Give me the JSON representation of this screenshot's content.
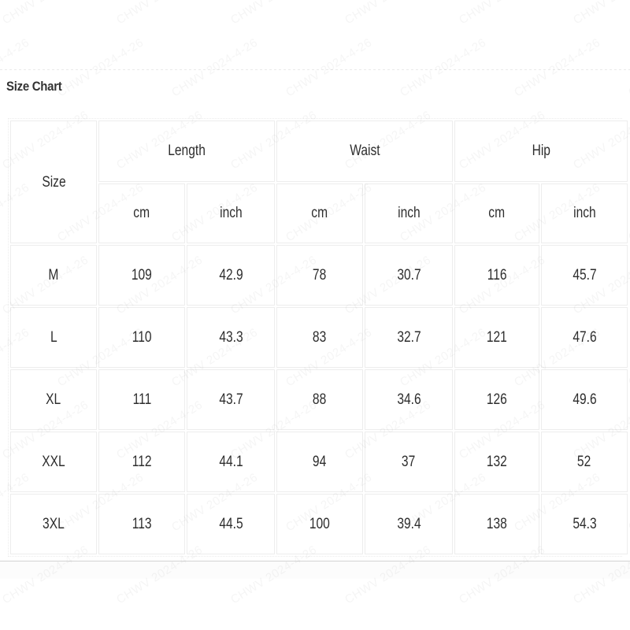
{
  "page": {
    "title": "Size Chart",
    "background_color": "#ffffff",
    "text_color": "#2d2d2d",
    "border_color": "#ededed",
    "rule_color": "#d4d4d4"
  },
  "watermark": {
    "text": "CHWV 2024-4-26",
    "color": "rgba(140,140,140,0.085)"
  },
  "table": {
    "size_header": "Size",
    "group_headers": [
      {
        "label": "Length"
      },
      {
        "label": "Waist"
      },
      {
        "label": "Hip"
      }
    ],
    "unit_headers": [
      "cm",
      "inch",
      "cm",
      "inch",
      "cm",
      "inch"
    ],
    "columns": [
      "Size",
      "Length cm",
      "Length inch",
      "Waist cm",
      "Waist inch",
      "Hip cm",
      "Hip inch"
    ],
    "rows": [
      {
        "size": "M",
        "length_cm": "109",
        "length_inch": "42.9",
        "waist_cm": "78",
        "waist_inch": "30.7",
        "hip_cm": "116",
        "hip_inch": "45.7"
      },
      {
        "size": "L",
        "length_cm": "110",
        "length_inch": "43.3",
        "waist_cm": "83",
        "waist_inch": "32.7",
        "hip_cm": "121",
        "hip_inch": "47.6"
      },
      {
        "size": "XL",
        "length_cm": "111",
        "length_inch": "43.7",
        "waist_cm": "88",
        "waist_inch": "34.6",
        "hip_cm": "126",
        "hip_inch": "49.6"
      },
      {
        "size": "XXL",
        "length_cm": "112",
        "length_inch": "44.1",
        "waist_cm": "94",
        "waist_inch": "37",
        "hip_cm": "132",
        "hip_inch": "52"
      },
      {
        "size": "3XL",
        "length_cm": "113",
        "length_inch": "44.5",
        "waist_cm": "100",
        "waist_inch": "39.4",
        "hip_cm": "138",
        "hip_inch": "54.3"
      }
    ]
  },
  "chart_data": {
    "type": "table",
    "title": "Size Chart",
    "columns": [
      "Size",
      "Length (cm)",
      "Length (inch)",
      "Waist (cm)",
      "Waist (inch)",
      "Hip (cm)",
      "Hip (inch)"
    ],
    "categories": [
      "M",
      "L",
      "XL",
      "XXL",
      "3XL"
    ],
    "series": [
      {
        "name": "Length (cm)",
        "values": [
          109,
          110,
          111,
          112,
          113
        ]
      },
      {
        "name": "Length (inch)",
        "values": [
          42.9,
          43.3,
          43.7,
          44.1,
          44.5
        ]
      },
      {
        "name": "Waist (cm)",
        "values": [
          78,
          83,
          88,
          94,
          100
        ]
      },
      {
        "name": "Waist (inch)",
        "values": [
          30.7,
          32.7,
          34.6,
          37,
          39.4
        ]
      },
      {
        "name": "Hip (cm)",
        "values": [
          116,
          121,
          126,
          132,
          138
        ]
      },
      {
        "name": "Hip (inch)",
        "values": [
          45.7,
          47.6,
          49.6,
          52,
          54.3
        ]
      }
    ]
  }
}
